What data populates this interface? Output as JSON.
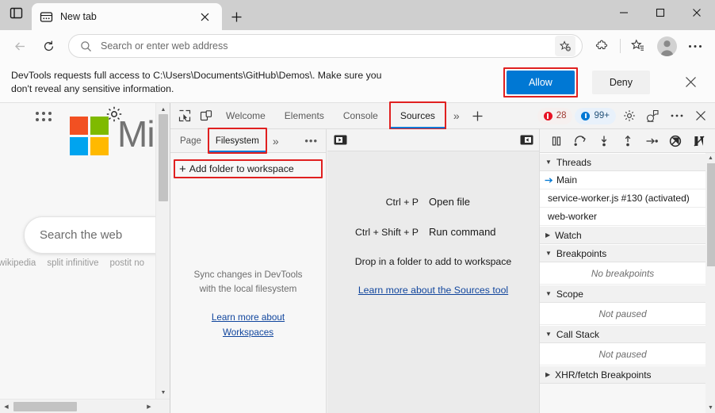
{
  "browser": {
    "tab": {
      "title": "New tab",
      "favicon_icon": "page-favicon-icon",
      "close_icon": "close-icon"
    },
    "tab_search_icon": "tab-search-icon",
    "new_tab_icon": "plus-icon",
    "window_controls": {
      "minimize": "minimize-icon",
      "maximize": "maximize-icon",
      "close": "close-icon"
    },
    "address_bar": {
      "back_icon": "back-arrow-icon",
      "refresh_icon": "refresh-icon",
      "search_icon": "search-icon",
      "placeholder": "Search or enter web address",
      "favorite_add_icon": "favorite-add-icon",
      "extensions_icon": "extensions-icon",
      "collections_icon": "collections-icon",
      "profile_icon": "profile-avatar-icon",
      "settings_icon": "more-options-icon"
    }
  },
  "notification": {
    "message_line1": "DevTools requests full access to C:\\Users\\Documents\\GitHub\\Demos\\. Make sure you",
    "message_line2": "don't reveal any sensitive information.",
    "allow_label": "Allow",
    "deny_label": "Deny",
    "close_icon": "close-icon",
    "allow_color": "#0078d4",
    "highlight_color": "#e02020"
  },
  "page": {
    "apps_icon": "app-grid-icon",
    "gear_icon": "gear-icon",
    "logo_icon": "microsoft-logo-icon",
    "wordmark": "Mi",
    "search_placeholder": "Search the web",
    "suggestions": [
      "wikipedia",
      "split infinitive",
      "postit no"
    ],
    "logo_colors": {
      "red": "#f25022",
      "green": "#7fba00",
      "blue": "#00a4ef",
      "yellow": "#ffb900"
    }
  },
  "devtools": {
    "inspect_icon": "inspect-element-icon",
    "device_toggle_icon": "device-emulation-icon",
    "tabs": [
      {
        "label": "Welcome",
        "active": false
      },
      {
        "label": "Elements",
        "active": false
      },
      {
        "label": "Console",
        "active": false
      },
      {
        "label": "Sources",
        "active": true,
        "highlighted": true
      }
    ],
    "more_tabs_icon": "chevron-double-right-icon",
    "add_tab_icon": "plus-icon",
    "error_badge": {
      "count": "28",
      "icon": "error-circle-icon"
    },
    "message_badge": {
      "count": "99+",
      "icon": "message-circle-icon"
    },
    "settings_icon": "gear-icon",
    "feedback_icon": "feedback-icon",
    "more_icon": "more-options-icon",
    "close_icon": "close-icon",
    "accent_color": "#0078d4"
  },
  "navigator": {
    "subtabs": [
      {
        "label": "Page",
        "active": false
      },
      {
        "label": "Filesystem",
        "active": true,
        "highlighted": true
      }
    ],
    "more_icon": "chevron-double-right-icon",
    "options_icon": "more-options-icon",
    "add_folder_label": "Add folder to workspace",
    "add_folder_plus": "+",
    "empty_line1": "Sync changes in DevTools",
    "empty_line2": "with the local filesystem",
    "learn_line1": "Learn more about",
    "learn_line2": "Workspaces"
  },
  "editor": {
    "panel_left_icon": "show-navigator-icon",
    "panel_right_icon": "show-debugger-icon",
    "shortcuts": [
      {
        "keys": "Ctrl + P",
        "desc": "Open file"
      },
      {
        "keys": "Ctrl + Shift + P",
        "desc": "Run command"
      }
    ],
    "drop_hint": "Drop in a folder to add to workspace",
    "learn_link": "Learn more about the Sources tool"
  },
  "debugger": {
    "toolbar": [
      {
        "icon": "pause-icon",
        "name": "pause-script-execution"
      },
      {
        "icon": "step-over-icon",
        "name": "step-over-next-call"
      },
      {
        "icon": "step-into-icon",
        "name": "step-into-next-call"
      },
      {
        "icon": "step-out-icon",
        "name": "step-out-of-current-function"
      },
      {
        "icon": "step-icon",
        "name": "step"
      },
      {
        "icon": "deactivate-breakpoints-icon",
        "name": "deactivate-breakpoints"
      },
      {
        "icon": "pause-on-exceptions-icon",
        "name": "pause-on-exceptions"
      }
    ],
    "sections": [
      {
        "title": "Threads",
        "expanded": true,
        "items": [
          {
            "label": "Main",
            "selected": true,
            "icon": "arrow-right-icon"
          },
          {
            "label": "service-worker.js #130 (activated)",
            "selected": false
          },
          {
            "label": "web-worker",
            "selected": false
          }
        ]
      },
      {
        "title": "Watch",
        "expanded": false,
        "items": []
      },
      {
        "title": "Breakpoints",
        "expanded": true,
        "empty_text": "No breakpoints"
      },
      {
        "title": "Scope",
        "expanded": true,
        "empty_text": "Not paused"
      },
      {
        "title": "Call Stack",
        "expanded": true,
        "empty_text": "Not paused"
      },
      {
        "title": "XHR/fetch Breakpoints",
        "expanded": false,
        "items": []
      }
    ]
  }
}
